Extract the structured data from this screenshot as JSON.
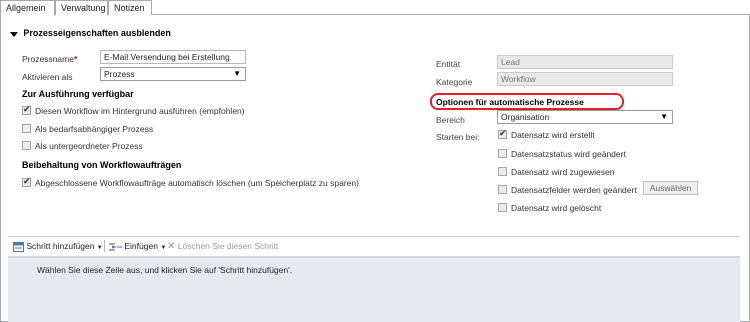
{
  "tabs": [
    "Allgemein",
    "Verwaltung",
    "Notizen"
  ],
  "section": {
    "title": "Prozesseigenschaften ausblenden"
  },
  "left": {
    "prozessname_label": "Prozessname",
    "prozessname_required": "*",
    "prozessname_value": "E-Mail Versendung bei Erstellung eines n",
    "aktivieren_label": "Aktivieren als",
    "aktivieren_value": "Prozess",
    "ausfuehrung_heading": "Zur Ausführung verfügbar",
    "ausfuehrung_options": [
      {
        "label": "Diesen Workflow im Hintergrund ausführen (empfohlen)",
        "checked": true
      },
      {
        "label": "Als bedarfsabhängiger Prozess",
        "checked": false
      },
      {
        "label": "Als untergeordneter Prozess",
        "checked": false
      }
    ],
    "beibehaltung_heading": "Beibehaltung von Workflowaufträgen",
    "beibehaltung_option": {
      "label": "Abgeschlossene Workflowaufträge automatisch löschen (um Speicherplatz zu sparen)",
      "checked": true
    }
  },
  "right": {
    "entitaet_label": "Entität",
    "entitaet_value": "Lead",
    "kategorie_label": "Kategorie",
    "kategorie_value": "Workflow",
    "optionen_heading": "Optionen für automatische Prozesse",
    "bereich_label": "Bereich",
    "bereich_value": "Organisation",
    "starten_label": "Starten bei:",
    "starten_options": [
      {
        "label": "Datensatz wird erstellt",
        "checked": true
      },
      {
        "label": "Datensatzstatus wird geändert",
        "checked": false
      },
      {
        "label": "Datensatz wird zugewiesen",
        "checked": false
      },
      {
        "label": "Datensatzfelder werden geändert",
        "checked": false
      },
      {
        "label": "Datensatz wird gelöscht",
        "checked": false
      }
    ],
    "auswaehlen_button": "Auswählen"
  },
  "toolbar": {
    "schritt_hinzufuegen": "Schritt hinzufügen",
    "einfuegen": "Einfügen",
    "loeschen": "Löschen Sie diesen Schritt"
  },
  "steps_hint": "Wählen Sie diese Zeile aus, und klicken Sie auf 'Schritt hinzufügen'.",
  "colors": {
    "highlight": "#e0202a",
    "grid_background": "#e6e9ee",
    "readonly_field": "#e9e9e9"
  }
}
